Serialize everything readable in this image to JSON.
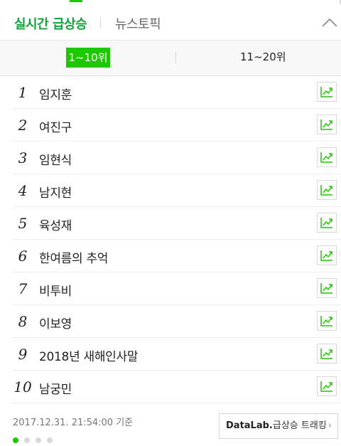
{
  "header": {
    "active_tab": "실시간 급상승",
    "inactive_tab": "뉴스토픽"
  },
  "rank_tabs": [
    {
      "label": "1~10위",
      "selected": true
    },
    {
      "label": "11~20위",
      "selected": false
    }
  ],
  "keywords": [
    {
      "rank": "1",
      "text": "임지훈"
    },
    {
      "rank": "2",
      "text": "여진구"
    },
    {
      "rank": "3",
      "text": "임현식"
    },
    {
      "rank": "4",
      "text": "남지현"
    },
    {
      "rank": "5",
      "text": "육성재"
    },
    {
      "rank": "6",
      "text": "한여름의 추억"
    },
    {
      "rank": "7",
      "text": "비투비"
    },
    {
      "rank": "8",
      "text": "이보영"
    },
    {
      "rank": "9",
      "text": "2018년 새해인사말"
    },
    {
      "rank": "10",
      "text": "남궁민"
    }
  ],
  "footer": {
    "timestamp": "2017.12.31. 21:54:00 기준",
    "datalab_brand": "DataLab.",
    "datalab_text": "급상승 트래킹",
    "datalab_chevron": "›",
    "page_count": 4,
    "active_page": 1
  },
  "colors": {
    "accent": "#1ec800",
    "title_green": "#12a33b"
  },
  "icons": {
    "collapse": "chevron-up-icon",
    "trend": "trend-chart-icon"
  }
}
